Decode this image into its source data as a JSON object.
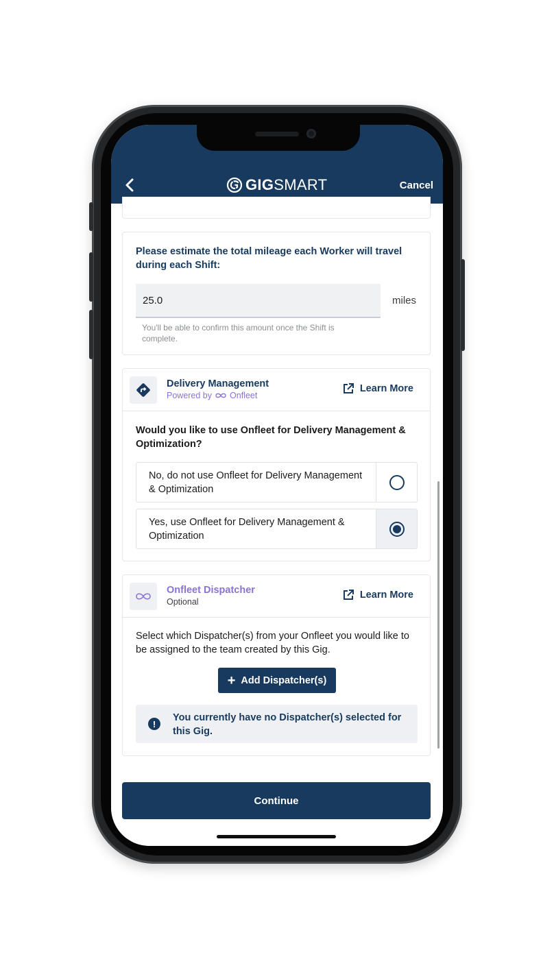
{
  "header": {
    "logo_bold": "GIG",
    "logo_light": "SMART",
    "cancel_label": "Cancel"
  },
  "mileage": {
    "question": "Please estimate the total mileage each Worker will travel during each Shift:",
    "value": "25.0",
    "unit": "miles",
    "helper": "You'll be able to confirm this amount once the Shift is complete."
  },
  "delivery": {
    "title": "Delivery Management",
    "powered_by": "Powered by",
    "partner": "Onfleet",
    "learn_more": "Learn More",
    "question": "Would you like to use Onfleet for Delivery Management & Optimization?",
    "options": [
      {
        "label": "No, do not use Onfleet for Delivery Management & Optimization",
        "selected": false
      },
      {
        "label": "Yes, use Onfleet for Delivery Management & Optimization",
        "selected": true
      }
    ]
  },
  "dispatcher": {
    "title": "Onfleet Dispatcher",
    "subtitle": "Optional",
    "learn_more": "Learn More",
    "description": "Select which Dispatcher(s) from your Onfleet you would like to be assigned to the team created by this Gig.",
    "add_label": "Add Dispatcher(s)",
    "notice": "You currently have no Dispatcher(s) selected for this Gig."
  },
  "footer": {
    "continue_label": "Continue"
  },
  "colors": {
    "brand_navy": "#173a5e",
    "onfleet_purple": "#8a72d8",
    "panel_gray": "#eef0f3"
  },
  "icons": [
    "back-chevron-icon",
    "gigsmart-logo-icon",
    "directions-icon",
    "infinity-icon",
    "external-link-icon",
    "plus-icon",
    "alert-icon"
  ]
}
